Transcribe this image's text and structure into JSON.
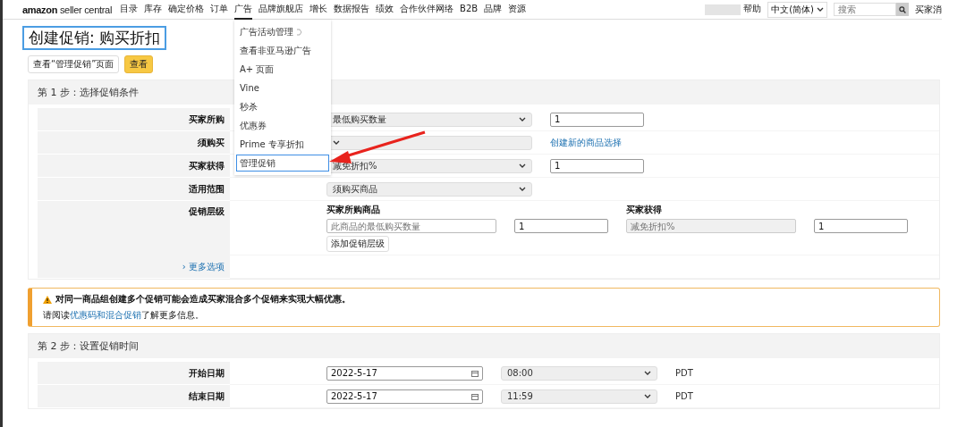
{
  "nav": {
    "logo": {
      "brand": "amazon",
      "product": "seller central"
    },
    "items": [
      {
        "label": "目录",
        "selected": false
      },
      {
        "label": "库存",
        "selected": false
      },
      {
        "label": "确定价格",
        "selected": false
      },
      {
        "label": "订单",
        "selected": false
      },
      {
        "label": "广告",
        "selected": true
      },
      {
        "label": "品牌旗舰店",
        "selected": false
      },
      {
        "label": "增长",
        "selected": false
      },
      {
        "label": "数据报告",
        "selected": false
      },
      {
        "label": "绩效",
        "selected": false
      },
      {
        "label": "合作伙伴网络",
        "selected": false
      },
      {
        "label": "B2B",
        "selected": false
      },
      {
        "label": "品牌",
        "selected": false
      },
      {
        "label": "资源",
        "selected": false
      }
    ],
    "help": "帮助",
    "language": "中文(简体)",
    "search": {
      "placeholder": "搜索"
    },
    "account": "买家消"
  },
  "menu": [
    {
      "label": "广告活动管理",
      "external": true,
      "selected": false
    },
    {
      "label": "查看非亚马逊广告",
      "external": false,
      "selected": false
    },
    {
      "label": "A+ 页面",
      "external": false,
      "selected": false
    },
    {
      "label": "Vine",
      "external": false,
      "selected": false
    },
    {
      "label": "秒杀",
      "external": false,
      "selected": false
    },
    {
      "label": "优惠券",
      "external": false,
      "selected": false
    },
    {
      "label": "Prime 专享折扣",
      "external": false,
      "selected": false
    },
    {
      "label": "管理促销",
      "external": false,
      "selected": true
    }
  ],
  "title": "创建促销: 购买折扣",
  "buttons": [
    {
      "label": "查看“管理促销”页面",
      "kind": "secondary"
    },
    {
      "label": "查看",
      "kind": "primary"
    }
  ],
  "step1": {
    "title": "第 1 步：选择促销条件",
    "rows": [
      {
        "label": "买家所购",
        "select": "最低购买数量",
        "extra": {
          "kind": "input",
          "value": "1"
        }
      },
      {
        "label": "须购买",
        "extra": {
          "kind": "link",
          "text": "创建新的商品选择"
        }
      },
      {
        "label": "买家获得",
        "select": "减免折扣%",
        "extra": {
          "kind": "input",
          "value": "1"
        }
      },
      {
        "label": "适用范围",
        "select": "须购买商品"
      }
    ],
    "tier": {
      "label": "促销层级",
      "headings": [
        "买家所购商品",
        "买家获得"
      ],
      "fields": [
        {
          "kind": "input",
          "placeholder": "此商品的最低购买数量",
          "disabled": false,
          "wide": true
        },
        {
          "kind": "input",
          "value": "1",
          "disabled": false,
          "wide": false
        },
        {
          "kind": "input",
          "placeholder": "减免折扣%",
          "disabled": true,
          "wide": true
        },
        {
          "kind": "input",
          "value": "1",
          "disabled": false,
          "wide": false
        }
      ],
      "add_button": "添加促销层级"
    },
    "more": "› 更多选项"
  },
  "warning": {
    "title": "对同一商品组创建多个促销可能会造成买家混合多个促销来实现大幅优惠。",
    "before": "请阅读",
    "link": "优惠码和混合促销",
    "after": "了解更多信息。"
  },
  "step2": {
    "title": "第 2 步：设置促销时间",
    "rows": [
      {
        "label": "开始日期",
        "date": "2022-5-17",
        "time": "08:00",
        "zone": "PDT"
      },
      {
        "label": "结束日期",
        "date": "2022-5-17",
        "time": "11:59",
        "zone": "PDT"
      }
    ]
  }
}
